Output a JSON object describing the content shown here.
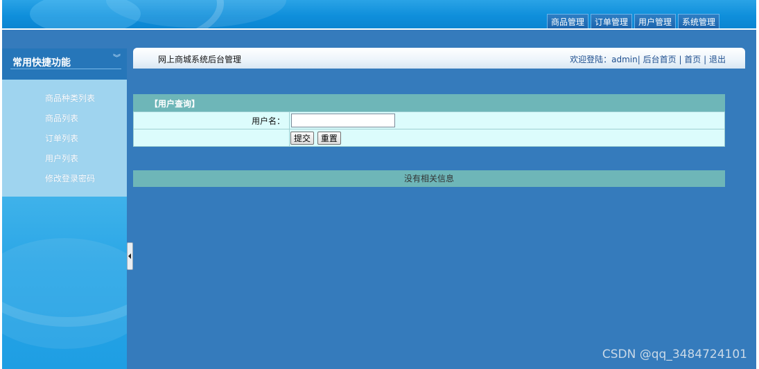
{
  "top_nav": {
    "tabs": [
      "商品管理",
      "订单管理",
      "用户管理",
      "系统管理"
    ]
  },
  "sidebar": {
    "title": "常用快捷功能",
    "collapse_icon": "double-chevron-down-icon",
    "items": [
      "商品种类列表",
      "商品列表",
      "订单列表",
      "用户列表",
      "修改登录密码"
    ]
  },
  "header": {
    "title": "网上商城系统后台管理",
    "welcome_prefix": "欢迎登陆：",
    "username": "admin",
    "links": [
      "后台首页",
      "首页",
      "退出"
    ]
  },
  "query": {
    "title": "【用户查询】",
    "username_label": "用户名：",
    "username_value": "",
    "submit_label": "提交",
    "reset_label": "重置"
  },
  "results": {
    "empty_text": "没有相关信息"
  },
  "watermark": "CSDN @qq_3484724101",
  "colors": {
    "header_blue": "#0f8fdb",
    "content_bg": "#357bbc",
    "menu_bg": "#9fd4ef",
    "panel_head": "#6eb6b8",
    "panel_row": "#dcfcfc"
  }
}
